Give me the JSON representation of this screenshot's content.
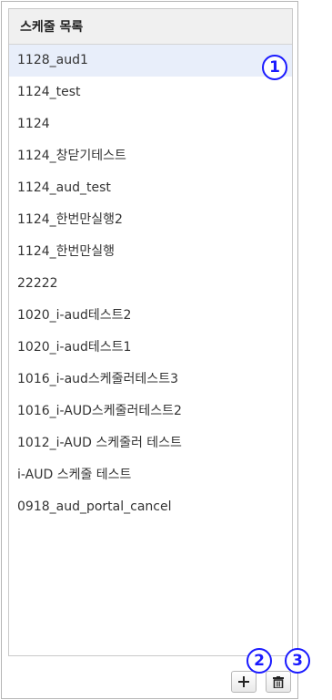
{
  "panel": {
    "title": "스케줄 목록"
  },
  "schedules": [
    "1128_aud1",
    "1124_test",
    "1124",
    "1124_창닫기테스트",
    "1124_aud_test",
    "1124_한번만실행2",
    "1124_한번만실행",
    "22222",
    "1020_i-aud테스트2",
    "1020_i-aud테스트1",
    "1016_i-aud스케줄러테스트3",
    "1016_i-AUD스케줄러테스트2",
    "1012_i-AUD 스케줄러 테스트",
    "i-AUD 스케줄 테스트",
    "0918_aud_portal_cancel"
  ],
  "selected_index": 0,
  "toolbar": {
    "add_icon": "plus-icon",
    "delete_icon": "trash-icon"
  },
  "badges": {
    "one": "1",
    "two": "2",
    "three": "3"
  },
  "colors": {
    "badge": "#1a1aff",
    "selected_row": "#e8eefa"
  }
}
